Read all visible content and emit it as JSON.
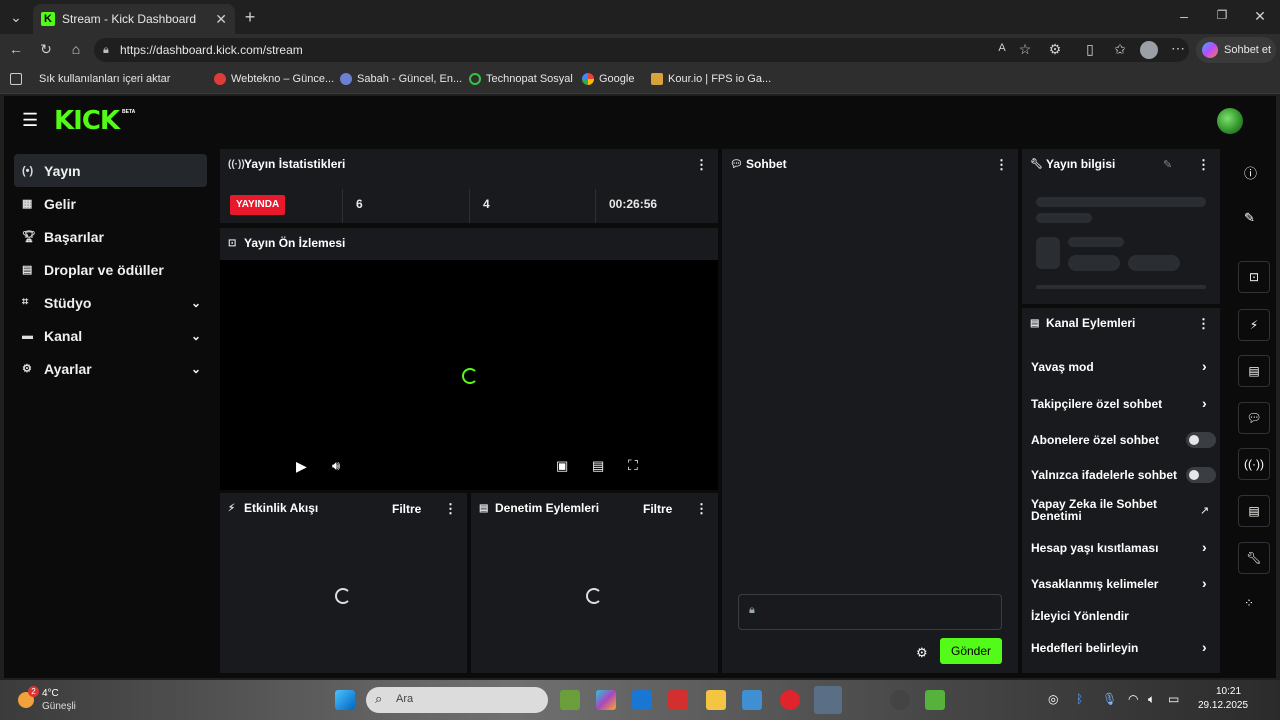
{
  "browser": {
    "tab_title": "Stream - Kick Dashboard",
    "tab_close": "✕",
    "new_tab": "+",
    "url": "https://dashboard.kick.com/stream",
    "copilot_label": "Sohbet et",
    "bookmarks": [
      {
        "label": "Sık kullanılanları içeri aktar"
      },
      {
        "label": "Webtekno – Günce..."
      },
      {
        "label": "Sabah - Güncel, En..."
      },
      {
        "label": "Technopat Sosyal"
      },
      {
        "label": "Google"
      },
      {
        "label": "Kour.io | FPS io Ga..."
      }
    ]
  },
  "app": {
    "logo": "KICK",
    "logo_badge": "BETA",
    "sidebar": [
      {
        "label": "Yayın"
      },
      {
        "label": "Gelir"
      },
      {
        "label": "Başarılar"
      },
      {
        "label": "Droplar ve ödüller"
      },
      {
        "label": "Stüdyo"
      },
      {
        "label": "Kanal"
      },
      {
        "label": "Ayarlar"
      }
    ],
    "stats": {
      "title": "Yayın İstatistikleri",
      "live_badge": "YAYINDA",
      "viewers": "6",
      "followers": "4",
      "duration": "00:26:56"
    },
    "preview": {
      "title": "Yayın Ön İzlemesi"
    },
    "activity": {
      "title": "Etkinlik Akışı",
      "filter": "Filtre"
    },
    "moderation": {
      "title": "Denetim Eylemleri",
      "filter": "Filtre"
    },
    "chat": {
      "title": "Sohbet",
      "send": "Gönder"
    },
    "stream_info": {
      "title": "Yayın bilgisi"
    },
    "channel_actions": {
      "title": "Kanal Eylemleri",
      "items": [
        {
          "label": "Yavaş mod"
        },
        {
          "label": "Takipçilere özel sohbet"
        },
        {
          "label": "Abonelere özel sohbet"
        },
        {
          "label": "Yalnızca ifadelerle sohbet"
        },
        {
          "label": "Yapay Zeka ile Sohbet Denetimi"
        },
        {
          "label": "Hesap yaşı kısıtlaması"
        },
        {
          "label": "Yasaklanmış kelimeler"
        },
        {
          "label": "İzleyici Yönlendir"
        },
        {
          "label": "Hedefleri belirleyin"
        }
      ]
    }
  },
  "taskbar": {
    "weather_temp": "4°C",
    "weather_label": "Güneşli",
    "weather_badge": "2",
    "search_placeholder": "Ara",
    "time": "10:21",
    "date": "29.12.2025"
  },
  "colors": {
    "brand": "#53fc18",
    "live": "#e8192c",
    "panel": "#181a1d",
    "bg": "#0b0b0c"
  }
}
